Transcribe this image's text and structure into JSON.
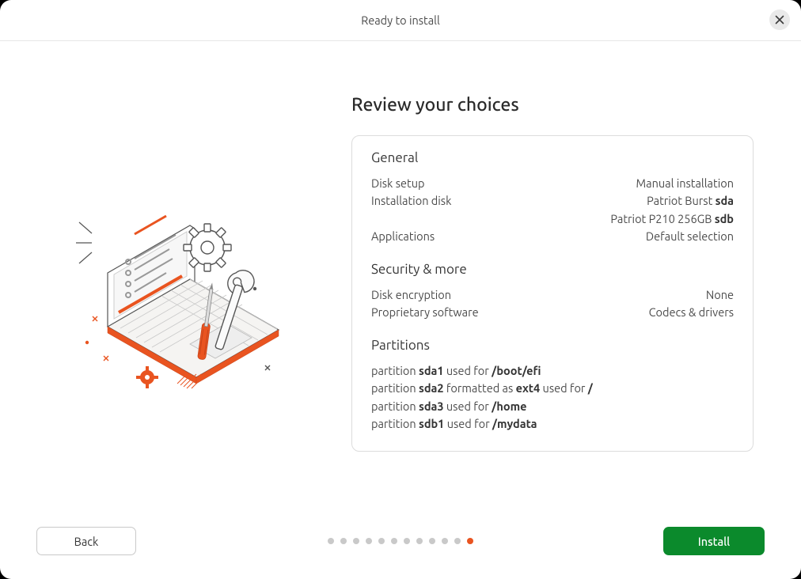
{
  "window": {
    "title": "Ready to install"
  },
  "heading": "Review your choices",
  "sections": {
    "general": {
      "title": "General",
      "disk_setup_label": "Disk setup",
      "disk_setup_value": "Manual installation",
      "install_disk_label": "Installation disk",
      "install_disk_line1_prefix": "Patriot Burst ",
      "install_disk_line1_bold": "sda",
      "install_disk_line2_prefix": "Patriot P210 256GB ",
      "install_disk_line2_bold": "sdb",
      "applications_label": "Applications",
      "applications_value": "Default selection"
    },
    "security": {
      "title": "Security & more",
      "disk_encryption_label": "Disk encryption",
      "disk_encryption_value": "None",
      "proprietary_label": "Proprietary software",
      "proprietary_value": "Codecs & drivers"
    },
    "partitions": {
      "title": "Partitions",
      "items": [
        {
          "pre": "partition ",
          "dev": "sda1",
          "mid": " used for ",
          "fs": "",
          "post": "",
          "mount": "/boot/efi"
        },
        {
          "pre": "partition ",
          "dev": "sda2",
          "mid": " formatted as ",
          "fs": "ext4",
          "post": " used for ",
          "mount": "/"
        },
        {
          "pre": "partition ",
          "dev": "sda3",
          "mid": " used for ",
          "fs": "",
          "post": "",
          "mount": "/home"
        },
        {
          "pre": "partition ",
          "dev": "sdb1",
          "mid": " used for ",
          "fs": "",
          "post": "",
          "mount": "/mydata"
        }
      ]
    }
  },
  "footer": {
    "back_label": "Back",
    "install_label": "Install",
    "steps_total": 12,
    "steps_current": 12
  },
  "colors": {
    "accent_orange": "#e95420",
    "install_green": "#0b8a2c"
  }
}
